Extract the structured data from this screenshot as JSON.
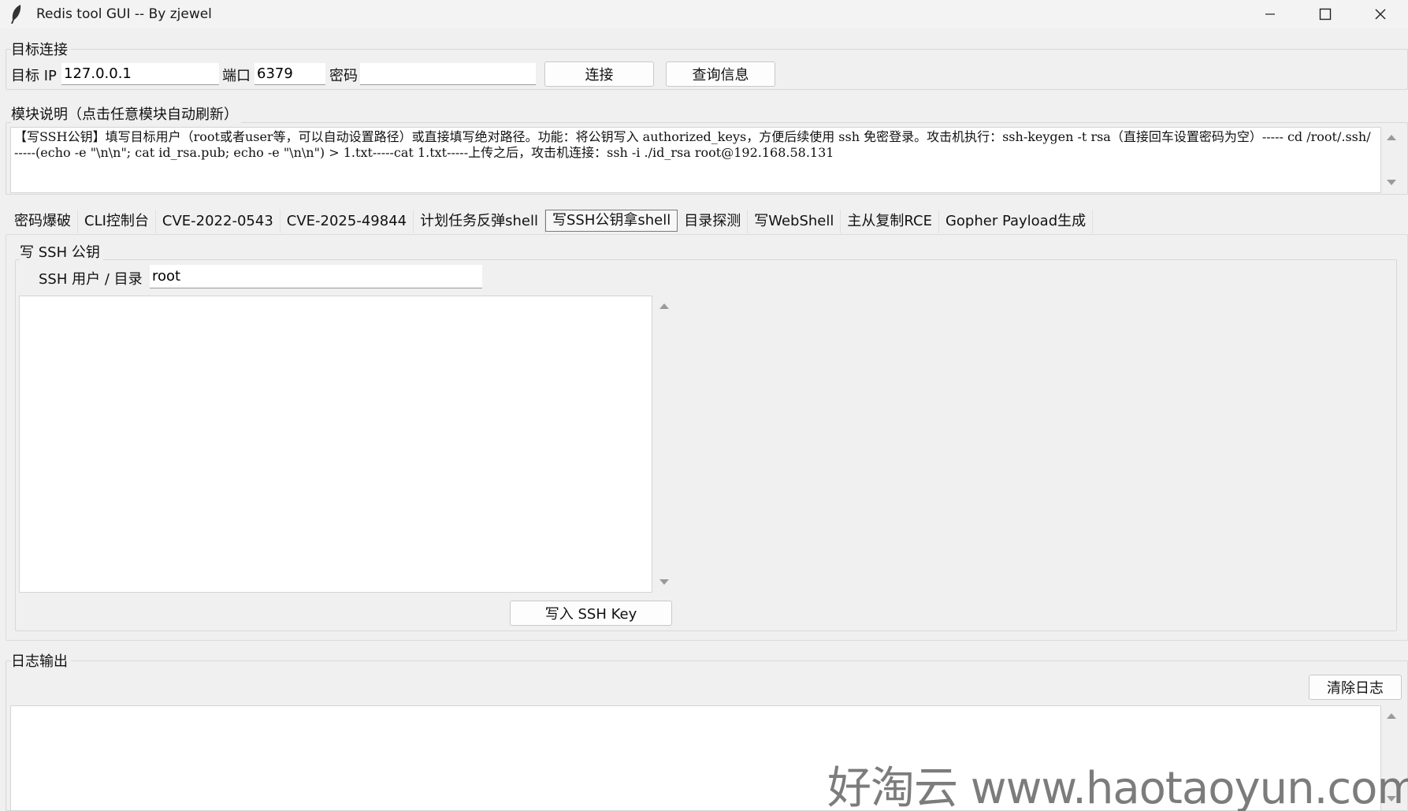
{
  "window": {
    "title": "Redis tool GUI -- By zjewel",
    "icon": "feather-icon",
    "controls": [
      "minimize-icon",
      "maximize-icon",
      "close-icon"
    ]
  },
  "connection": {
    "group_label": "目标连接",
    "ip_label": "目标 IP",
    "ip_value": "127.0.0.1",
    "port_label": "端口",
    "port_value": "6379",
    "password_label": "密码",
    "password_value": "",
    "connect_label": "连接",
    "query_label": "查询信息"
  },
  "description": {
    "group_label": "模块说明（点击任意模块自动刷新）",
    "text": "【写SSH公钥】填写目标用户（root或者user等，可以自动设置路径）或直接填写绝对路径。功能：将公钥写入 authorized_keys，方便后续使用 ssh 免密登录。攻击机执行：ssh-keygen -t rsa（直接回车设置密码为空）----- cd /root/.ssh/ -----(echo -e \"\\n\\n\"; cat id_rsa.pub; echo -e \"\\n\\n\") > 1.txt-----cat 1.txt-----上传之后，攻击机连接：ssh -i ./id_rsa root@192.168.58.131"
  },
  "tabs": [
    {
      "label": "密码爆破",
      "active": false
    },
    {
      "label": "CLI控制台",
      "active": false
    },
    {
      "label": "CVE-2022-0543",
      "active": false
    },
    {
      "label": "CVE-2025-49844",
      "active": false
    },
    {
      "label": "计划任务反弹shell",
      "active": false
    },
    {
      "label": "写SSH公钥拿shell",
      "active": true
    },
    {
      "label": "目录探测",
      "active": false
    },
    {
      "label": "写WebShell",
      "active": false
    },
    {
      "label": "主从复制RCE",
      "active": false
    },
    {
      "label": "Gopher Payload生成",
      "active": false
    }
  ],
  "ssh_panel": {
    "group_label": "写 SSH 公钥",
    "user_label": "SSH 用户 / 目录",
    "user_value": "root",
    "key_text": "",
    "write_button": "写入 SSH Key"
  },
  "log": {
    "group_label": "日志输出",
    "clear_button": "清除日志",
    "text": ""
  },
  "watermark": "好淘云 www.haotaoyun.com"
}
